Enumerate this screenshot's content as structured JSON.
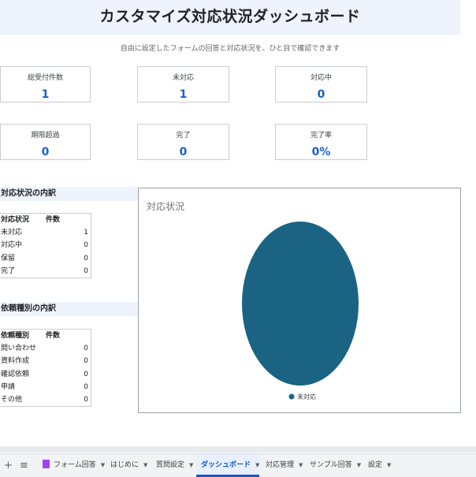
{
  "header": {
    "title": "カスタマイズ対応状況ダッシュボード",
    "subtitle": "自由に設定したフォームの回答と対応状況を、ひと目で確認できます"
  },
  "kpis": [
    {
      "label": "総受付件数",
      "value": "1"
    },
    {
      "label": "未対応",
      "value": "1"
    },
    {
      "label": "対応中",
      "value": "0"
    },
    {
      "label": "期限超過",
      "value": "0"
    },
    {
      "label": "完了",
      "value": "0"
    },
    {
      "label": "完了率",
      "value": "0%"
    }
  ],
  "status_section": {
    "title": "対応状況の内訳",
    "col1": "対応状況",
    "col2": "件数",
    "rows": [
      {
        "name": "未対応",
        "count": "1"
      },
      {
        "name": "対応中",
        "count": "0"
      },
      {
        "name": "保留",
        "count": "0"
      },
      {
        "name": "完了",
        "count": "0"
      }
    ]
  },
  "type_section": {
    "title": "依頼種別の内訳",
    "col1": "依頼種別",
    "col2": "件数",
    "rows": [
      {
        "name": "問い合わせ",
        "count": "0"
      },
      {
        "name": "資料作成",
        "count": "0"
      },
      {
        "name": "確認依頼",
        "count": "0"
      },
      {
        "name": "申請",
        "count": "0"
      },
      {
        "name": "その他",
        "count": "0"
      }
    ]
  },
  "chart_data": {
    "type": "pie",
    "title": "対応状況",
    "categories": [
      "未対応"
    ],
    "values": [
      1
    ],
    "colors": [
      "#1b6383"
    ],
    "legend": "bottom"
  },
  "tabbar": {
    "add_icon": "plus-icon",
    "menu_icon": "list-icon",
    "tabs": [
      {
        "label": "フォーム回答",
        "icon": "form-icon"
      },
      {
        "label": "はじめに"
      },
      {
        "label": "質問設定"
      },
      {
        "label": "ダッシュボード",
        "active": true
      },
      {
        "label": "対応管理"
      },
      {
        "label": "サンプル回答"
      },
      {
        "label": "設定"
      }
    ]
  },
  "colors": {
    "accent": "#1a5fd0",
    "header_band": "#eef3fc",
    "pie": "#1b6383"
  }
}
